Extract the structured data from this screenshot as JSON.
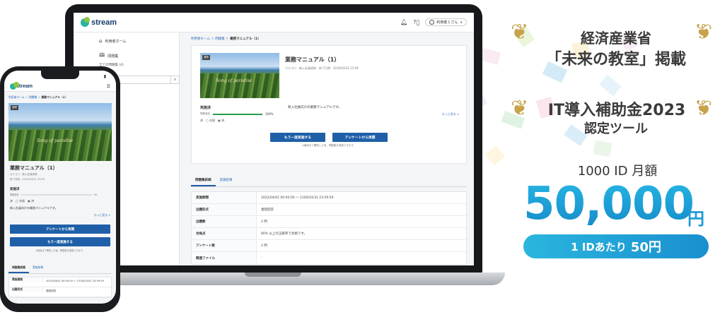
{
  "colors": {
    "accent": "#1f5fa8",
    "price": "#1d99d3",
    "laurel": "#c8a24a",
    "progress": "#2a9d4a"
  },
  "app": {
    "logo": "stream",
    "logo_sub": "",
    "user_name": "利用者１さん"
  },
  "sidebar": {
    "home": "利用者ホーム",
    "questions": "問題集",
    "all_questions": "全ての問題集 (4)",
    "search_placeholder": "ール"
  },
  "breadcrumb": {
    "home": "利用者ホーム",
    "sep1": " ＞ ",
    "questions": "問題集",
    "sep2": " ＞ ",
    "current": "業務マニュアル（1）"
  },
  "item": {
    "tag": "通常",
    "thumb_text": "Song of paradise",
    "title": "業務マニュアル（1）",
    "category": "カテゴリ：新入社員研修",
    "deadline": "終了日時：2100/03/31 23:59",
    "status": "実施済",
    "progress_label": "問題進捗",
    "progress_pct": "100%",
    "progress_value": 100,
    "icons_text": "済　□ 合格　▣ 済",
    "description": "新入社員向けの業務マニュアルです。",
    "more": "もっと見る ∨",
    "retry_button": "もう一度実施する",
    "survey_button": "アンケートから再開",
    "note": "※最後まで閲覧した後、問題集を実施できます。"
  },
  "tabs": {
    "details": "問題集詳細",
    "results": "実施結果"
  },
  "details": [
    {
      "k": "実施期間",
      "v": "2022/04/01 00:00:00 ～ 2100/03/31 23:59:59"
    },
    {
      "k": "出題形式",
      "v": "連続回答"
    },
    {
      "k": "出題数",
      "v": "2 問"
    },
    {
      "k": "合格点",
      "v": "80% 以上の正解率で合格です。"
    },
    {
      "k": "アンケート数",
      "v": "2 問"
    },
    {
      "k": "関連ファイル",
      "v": "-"
    }
  ],
  "phone": {
    "time": "",
    "progress_pct": "0%",
    "progress_value": 0,
    "period_value": "2022/04/01 00:00:00 ～ 2100/03/31 23:59:59",
    "format_label": "出題形式",
    "format_value": "連続回答"
  },
  "promo": {
    "line1": "経済産業省",
    "line2": "「未来の教室」掲載",
    "line3": "IT導入補助金2023",
    "line4": "認定ツール",
    "plan": "1000 ID 月額",
    "price": "50,000",
    "price_unit": "円",
    "per_id_prefix": "1 IDあたり",
    "per_id_value": "50円"
  }
}
